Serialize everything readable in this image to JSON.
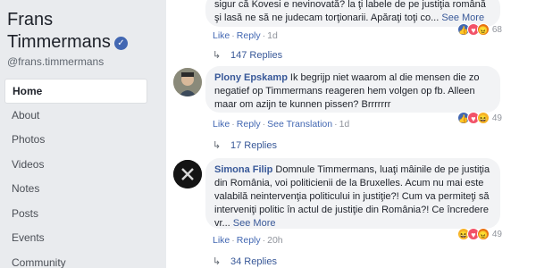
{
  "sidebar": {
    "page_name": "Frans Timmermans",
    "handle": "@frans.timmermans",
    "verified_icon": "check-badge-icon",
    "nav": [
      {
        "label": "Home",
        "active": true
      },
      {
        "label": "About"
      },
      {
        "label": "Photos"
      },
      {
        "label": "Videos"
      },
      {
        "label": "Notes"
      },
      {
        "label": "Posts"
      },
      {
        "label": "Events"
      },
      {
        "label": "Community"
      }
    ]
  },
  "comments": [
    {
      "text": "sigur că Kovesi e nevinovată? la ţi labele de pe justiţia română şi lasă ne să ne judecam torţionarii. Apăraţi toţi co...",
      "see_more": "See More",
      "actions": {
        "like": "Like",
        "reply": "Reply",
        "time": "1d"
      },
      "reactions": {
        "icons": [
          "like",
          "love",
          "angry"
        ],
        "count": "68"
      },
      "replies": "147 Replies"
    },
    {
      "author": "Plony Epskamp",
      "text": "Ik begrijp niet waarom al die mensen die zo negatief op Timmermans reageren hem volgen op fb. Alleen maar om azijn te kunnen pissen? Brrrrrrr",
      "actions": {
        "like": "Like",
        "reply": "Reply",
        "translation": "See Translation",
        "time": "1d"
      },
      "reactions": {
        "icons": [
          "like",
          "love",
          "haha"
        ],
        "count": "49"
      },
      "replies": "17 Replies"
    },
    {
      "author": "Simona Filip",
      "text": "Domnule Timmermans, luaţi mâinile de pe justiţia din România, voi politicienii de la Bruxelles. Acum nu mai este valabilă neintervenţia politicului in justiţie?! Cum va permiteţi să interveniţi politic în actul de justiţie din România?! Ce încredere vr...",
      "see_more": "See More",
      "actions": {
        "like": "Like",
        "reply": "Reply",
        "time": "20h"
      },
      "reactions": {
        "icons": [
          "haha",
          "love",
          "angry"
        ],
        "count": "49"
      },
      "replies": "34 Replies"
    }
  ],
  "colors": {
    "accent": "#4267b2",
    "link": "#385898",
    "background": "#e9ebee",
    "bubble": "#f2f3f5"
  }
}
